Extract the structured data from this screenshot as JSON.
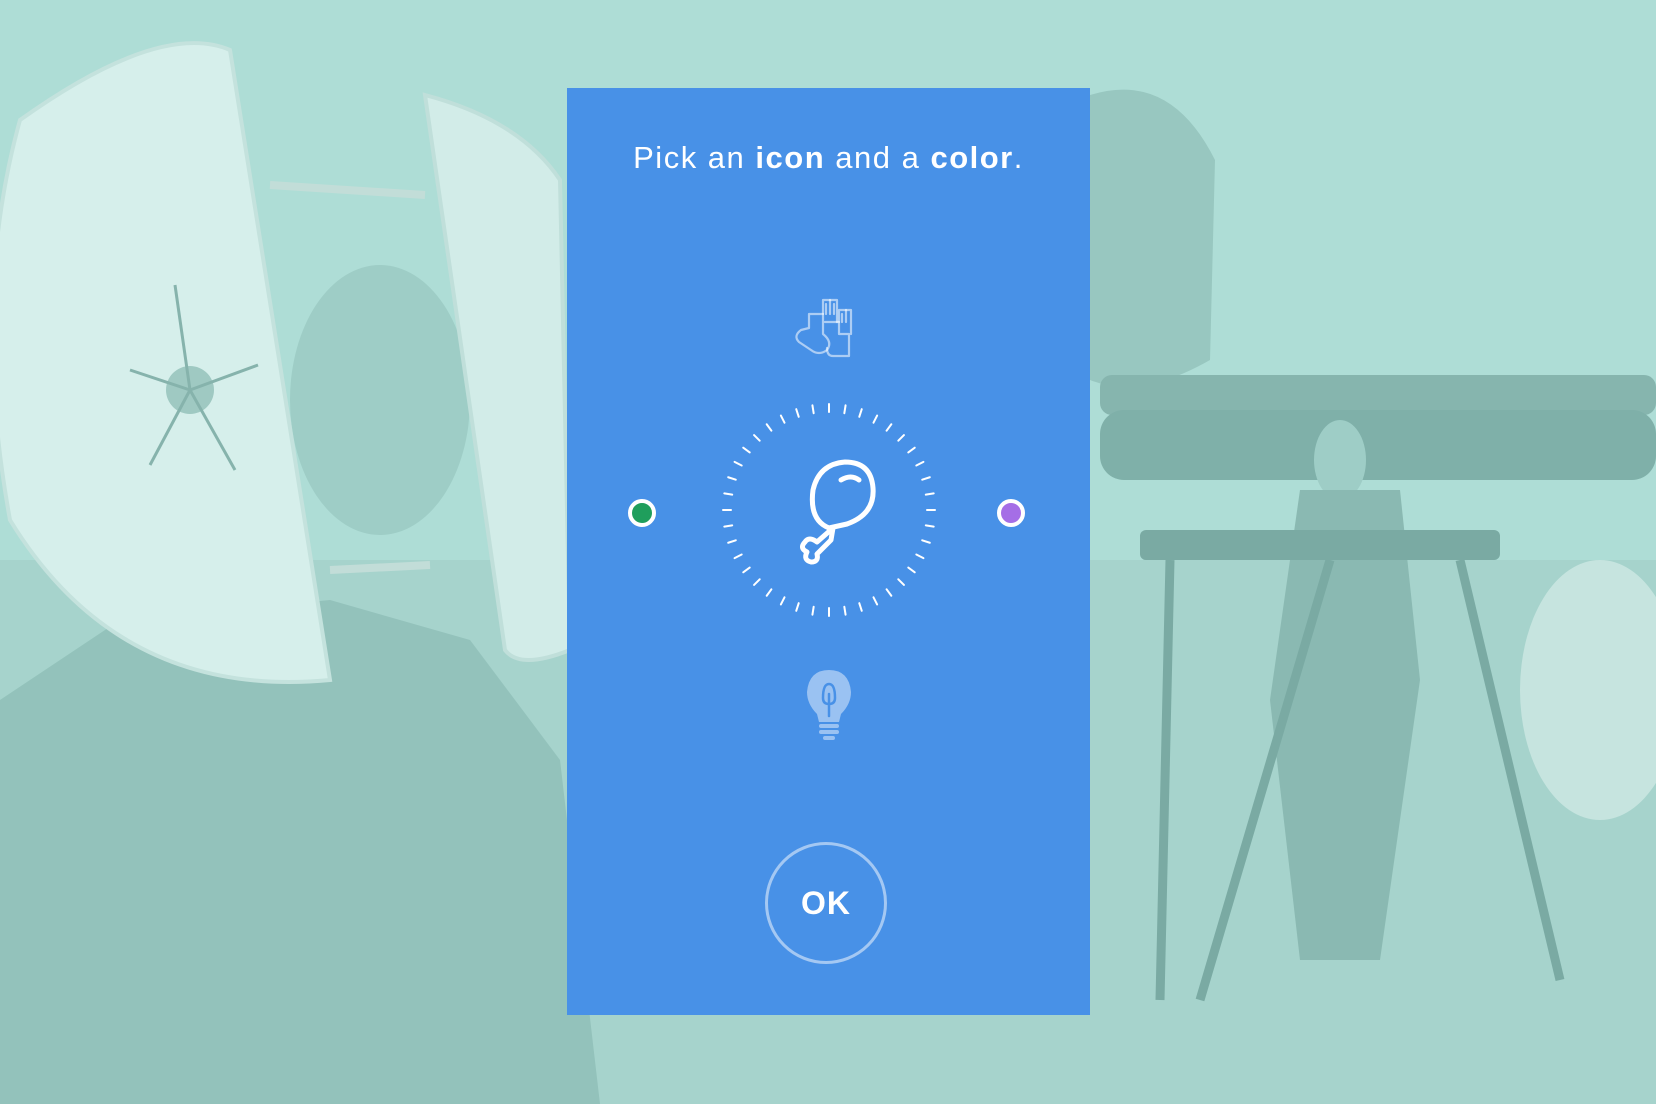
{
  "prompt": {
    "part1": "Pick an ",
    "word1": "icon",
    "part2": " and a ",
    "word2": "color",
    "part3": "."
  },
  "icons": {
    "previous": "socks-icon",
    "selected": "chicken-leg-icon",
    "next": "lightbulb-icon"
  },
  "colors": {
    "panel": "#4891e7",
    "background": "#aeddd6",
    "left_option": "#1f9e5c",
    "right_option": "#a56ee6"
  },
  "ok_button": {
    "label": "OK"
  }
}
